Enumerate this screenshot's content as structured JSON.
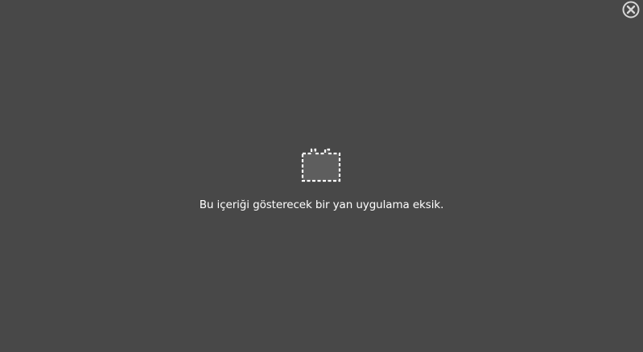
{
  "plugin_placeholder": {
    "message": "Bu içeriği gösterecek bir yan uygulama eksik.",
    "icon": "missing-plugin-icon"
  },
  "close_control": {
    "icon": "close-icon"
  },
  "colors": {
    "background": "#484848",
    "text": "#ffffff",
    "icon_fill": "#5e5e5e",
    "icon_border": "#ffffff"
  }
}
